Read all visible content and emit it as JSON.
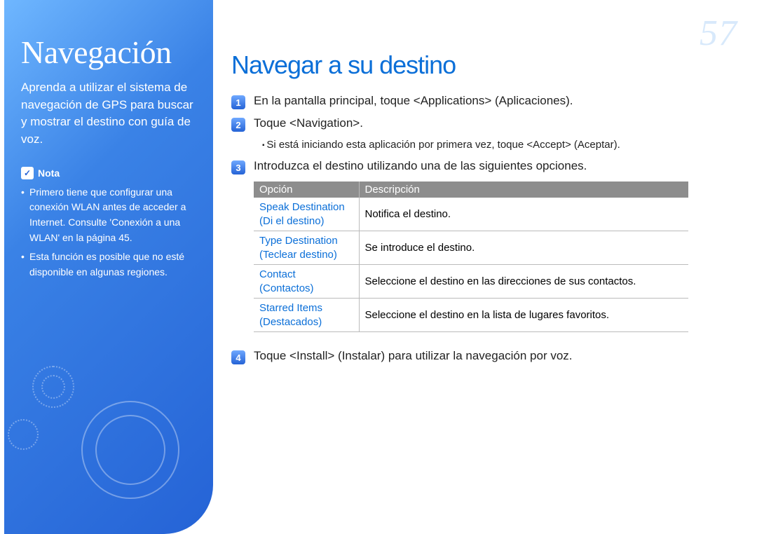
{
  "page_number": "57",
  "sidebar": {
    "title": "Navegación",
    "description": "Aprenda a utilizar el sistema de navegación de GPS para buscar y mostrar el destino con guía de voz.",
    "note_label": "Nota",
    "notes": [
      "Primero tiene que configurar una conexión WLAN antes de acceder a Internet. Consulte 'Conexión a una WLAN' en la página 45.",
      "Esta función es posible que no esté disponible en algunas regiones."
    ]
  },
  "main": {
    "title": "Navegar a su destino",
    "steps": {
      "s1": {
        "num": "1",
        "text": "En la pantalla principal, toque <Applications> (Aplicaciones)."
      },
      "s2": {
        "num": "2",
        "text": "Toque <Navigation>."
      },
      "s2_sub": "Si está iniciando esta aplicación por primera vez, toque <Accept> (Aceptar).",
      "s3": {
        "num": "3",
        "text": "Introduzca el destino utilizando una de las siguientes opciones."
      },
      "s4": {
        "num": "4",
        "text": "Toque <Install> (Instalar) para utilizar la navegación por voz."
      }
    },
    "table": {
      "headers": {
        "option": "Opción",
        "description": "Descripción"
      },
      "rows": [
        {
          "opt_en": "Speak Destination",
          "opt_es": "(Di el destino)",
          "desc": "Notifica el destino."
        },
        {
          "opt_en": "Type Destination",
          "opt_es": "(Teclear destino)",
          "desc": "Se introduce el destino."
        },
        {
          "opt_en": "Contact",
          "opt_es": "(Contactos)",
          "desc": "Seleccione el destino en las direcciones de sus contactos."
        },
        {
          "opt_en": "Starred Items",
          "opt_es": "(Destacados)",
          "desc": "Seleccione el destino en la lista de lugares favoritos."
        }
      ]
    }
  }
}
